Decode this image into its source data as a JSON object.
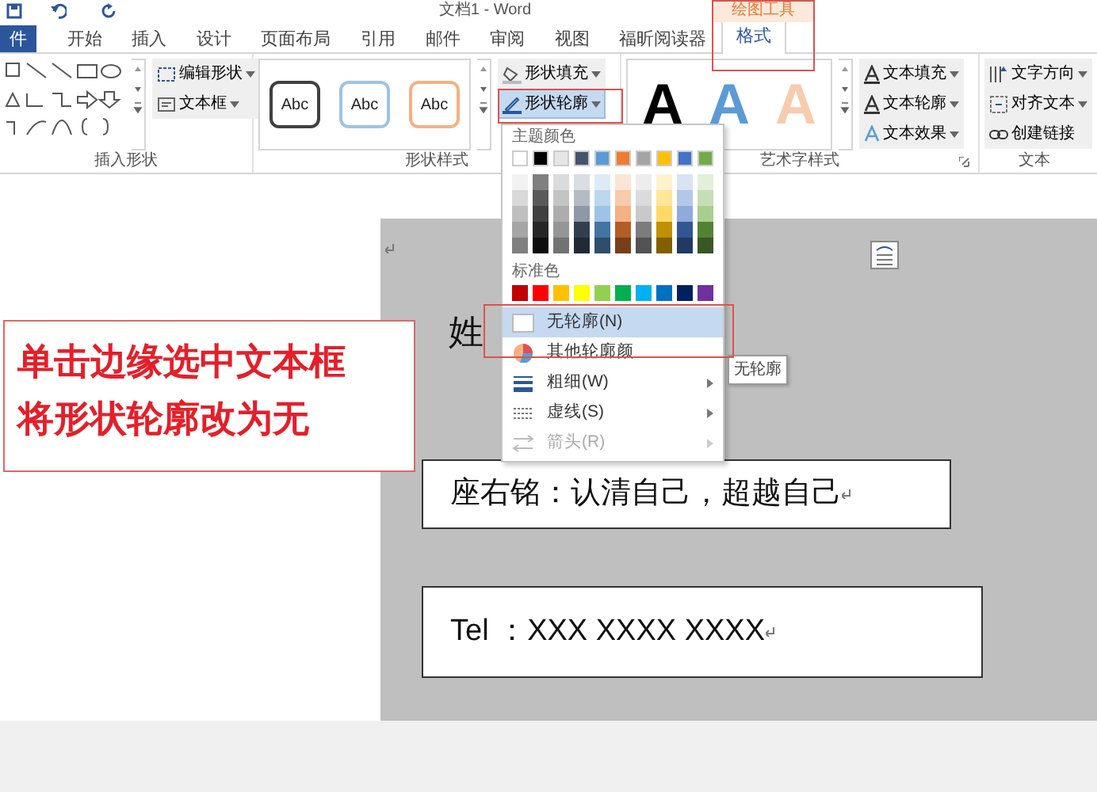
{
  "window": {
    "title": "文档1 - Word"
  },
  "context_group": {
    "label": "绘图工具"
  },
  "tabs": [
    {
      "label": "件",
      "kind": "file",
      "selected": false
    },
    {
      "label": "开始",
      "kind": "tab",
      "selected": false
    },
    {
      "label": "插入",
      "kind": "tab",
      "selected": false
    },
    {
      "label": "设计",
      "kind": "tab",
      "selected": false
    },
    {
      "label": "页面布局",
      "kind": "tab",
      "selected": false
    },
    {
      "label": "引用",
      "kind": "tab",
      "selected": false
    },
    {
      "label": "邮件",
      "kind": "tab",
      "selected": false
    },
    {
      "label": "审阅",
      "kind": "tab",
      "selected": false
    },
    {
      "label": "视图",
      "kind": "tab",
      "selected": false
    },
    {
      "label": "福昕阅读器",
      "kind": "tab",
      "selected": false
    },
    {
      "label": "格式",
      "kind": "tab",
      "selected": true
    }
  ],
  "ribbon": {
    "insert_shapes": {
      "label": "插入形状",
      "commands": [
        {
          "label": "编辑形状"
        },
        {
          "label": "文本框"
        }
      ]
    },
    "shape_styles": {
      "label": "形状样式",
      "samples": [
        {
          "text": "Abc",
          "color": "#404040"
        },
        {
          "text": "Abc",
          "color": "#9dc3e6"
        },
        {
          "text": "Abc",
          "color": "#f4b183"
        }
      ],
      "commands": [
        {
          "label": "形状填充",
          "selected": false
        },
        {
          "label": "形状轮廓",
          "selected": true
        }
      ]
    },
    "wordart_styles": {
      "label": "艺术字样式",
      "samples": [
        {
          "text": "A",
          "color": "#000000"
        },
        {
          "text": "A",
          "color": "#5b9bd5"
        },
        {
          "text": "A",
          "color": "#f8cbad"
        }
      ],
      "commands": [
        {
          "label": "文本填充"
        },
        {
          "label": "文本轮廓"
        },
        {
          "label": "文本效果"
        }
      ]
    },
    "text": {
      "label": "文本",
      "commands": [
        {
          "label": "文字方向",
          "dropdown": true
        },
        {
          "label": "对齐文本",
          "dropdown": true
        },
        {
          "label": "创建链接",
          "dropdown": false
        }
      ]
    }
  },
  "outline_menu": {
    "theme_header": "主题颜色",
    "theme_colors": [
      {
        "color": "#ffffff"
      },
      {
        "color": "#000000"
      },
      {
        "color": "#e7e6e6"
      },
      {
        "color": "#44546a"
      },
      {
        "color": "#5b9bd5"
      },
      {
        "color": "#ed7d31"
      },
      {
        "color": "#a5a5a5"
      },
      {
        "color": "#ffc000"
      },
      {
        "color": "#4472c4"
      },
      {
        "color": "#70ad47"
      }
    ],
    "standard_header": "标准色",
    "standard_colors": [
      {
        "color": "#c00000"
      },
      {
        "color": "#ff0000"
      },
      {
        "color": "#ffc000"
      },
      {
        "color": "#ffff00"
      },
      {
        "color": "#92d050"
      },
      {
        "color": "#00b050"
      },
      {
        "color": "#00b0f0"
      },
      {
        "color": "#0070c0"
      },
      {
        "color": "#002060"
      },
      {
        "color": "#7030a0"
      }
    ],
    "items": [
      {
        "label": "无轮廓(N)",
        "kind": "none",
        "selected": true,
        "submenu": false,
        "disabled": false
      },
      {
        "label": "其他轮廓颜",
        "kind": "more",
        "selected": false,
        "submenu": false,
        "disabled": false
      },
      {
        "label": "粗细(W)",
        "kind": "weight",
        "selected": false,
        "submenu": true,
        "disabled": false
      },
      {
        "label": "虚线(S)",
        "kind": "dash",
        "selected": false,
        "submenu": true,
        "disabled": false
      },
      {
        "label": "箭头(R)",
        "kind": "arrow",
        "selected": false,
        "submenu": true,
        "disabled": true
      }
    ],
    "tooltip": "无轮廓"
  },
  "annotation": {
    "lines": [
      "单击边缘选中文本框",
      "将形状轮廓改为无"
    ]
  },
  "document": {
    "name_line": "姓",
    "motto": "座右铭：认清自己，超越自己",
    "tel": "Tel ：XXX XXXX XXXX"
  }
}
